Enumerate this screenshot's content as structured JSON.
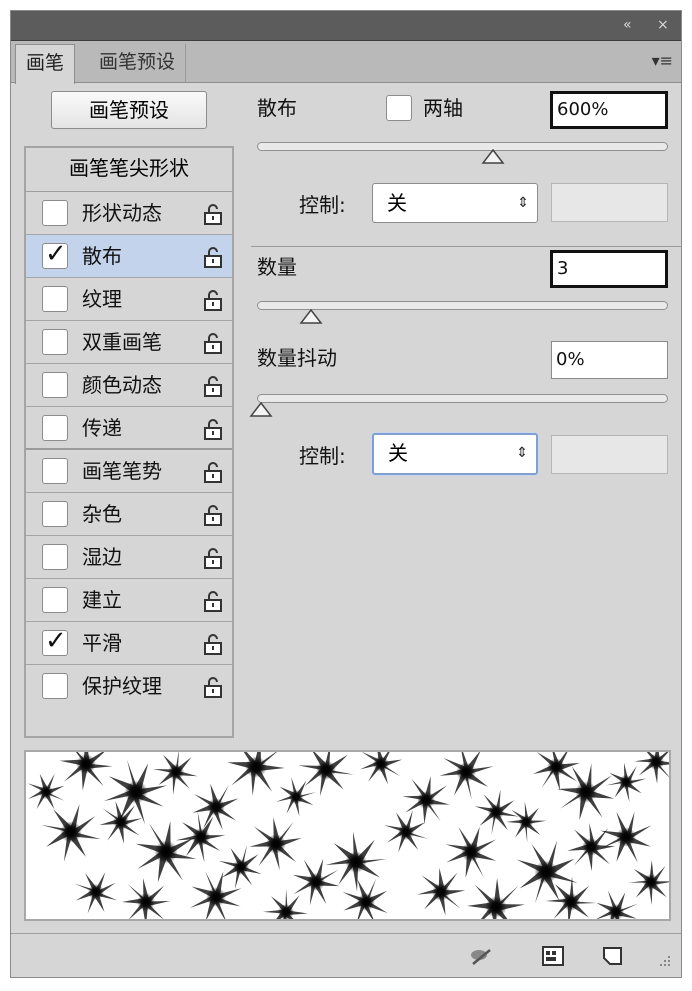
{
  "window_controls": {
    "collapse": "«",
    "close": "×"
  },
  "tabs": [
    {
      "label": "画笔",
      "active": true
    },
    {
      "label": "画笔预设",
      "active": false
    }
  ],
  "panel_menu": "▾≡",
  "preset_button": "画笔预设",
  "brush_tip_header": "画笔笔尖形状",
  "options": [
    {
      "label": "形状动态",
      "checked": false,
      "selected": false
    },
    {
      "label": "散布",
      "checked": true,
      "selected": true
    },
    {
      "label": "纹理",
      "checked": false,
      "selected": false
    },
    {
      "label": "双重画笔",
      "checked": false,
      "selected": false
    },
    {
      "label": "颜色动态",
      "checked": false,
      "selected": false
    },
    {
      "label": "传递",
      "checked": false,
      "selected": false
    },
    {
      "label": "画笔笔势",
      "checked": false,
      "selected": false
    },
    {
      "label": "杂色",
      "checked": false,
      "selected": false
    },
    {
      "label": "湿边",
      "checked": false,
      "selected": false
    },
    {
      "label": "建立",
      "checked": false,
      "selected": false
    },
    {
      "label": "平滑",
      "checked": true,
      "selected": false
    },
    {
      "label": "保护纹理",
      "checked": false,
      "selected": false
    }
  ],
  "check_glyph": "✓",
  "scatter": {
    "label": "散布",
    "both_axes_label": "两轴",
    "both_axes_checked": false,
    "value": "600%",
    "slider_fraction": 0.6
  },
  "scatter_control": {
    "label": "控制:",
    "value": "关"
  },
  "count": {
    "label": "数量",
    "value": "3",
    "slider_fraction": 0.13
  },
  "count_jitter": {
    "label": "数量抖动",
    "value": "0%",
    "slider_fraction": 0.0
  },
  "count_jitter_control": {
    "label": "控制:",
    "value": "关"
  },
  "select_arrow": "⇕",
  "accent": "#c4d3ec"
}
